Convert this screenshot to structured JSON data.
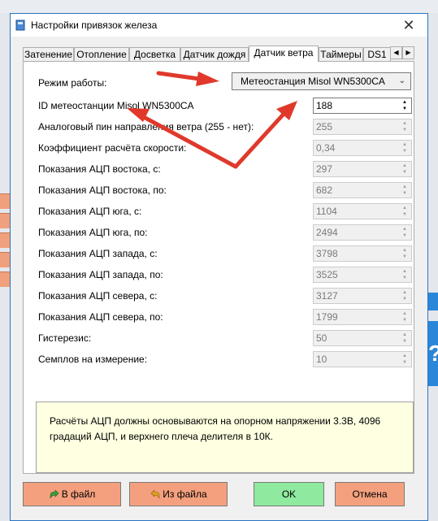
{
  "window": {
    "title": "Настройки привязок железа",
    "close_glyph": "✕"
  },
  "tabs": [
    "Затенение",
    "Отопление",
    "Досветка",
    "Датчик дождя",
    "Датчик ветра",
    "Таймеры",
    "DS1"
  ],
  "active_tab": "Датчик ветра",
  "tab_arrows": {
    "left": "◀",
    "right": "▶"
  },
  "form": {
    "mode_label": "Режим работы:",
    "mode_value": "Метеостанция Misol WN5300CA",
    "rows": [
      {
        "label": "ID метеостанции Misol WN5300CA",
        "value": "188",
        "enabled": true
      },
      {
        "label": "Аналоговый пин направления ветра (255 - нет):",
        "value": "255",
        "enabled": false
      },
      {
        "label": "Коэффициент расчёта скорости:",
        "value": "0,34",
        "enabled": false
      },
      {
        "label": "Показания АЦП востока, с:",
        "value": "297",
        "enabled": false
      },
      {
        "label": "Показания АЦП востока, по:",
        "value": "682",
        "enabled": false
      },
      {
        "label": "Показания АЦП юга, с:",
        "value": "1104",
        "enabled": false
      },
      {
        "label": "Показания АЦП юга, по:",
        "value": "2494",
        "enabled": false
      },
      {
        "label": "Показания АЦП запада, с:",
        "value": "3798",
        "enabled": false
      },
      {
        "label": "Показания АЦП запада, по:",
        "value": "3525",
        "enabled": false
      },
      {
        "label": "Показания АЦП севера, с:",
        "value": "3127",
        "enabled": false
      },
      {
        "label": "Показания АЦП севера, по:",
        "value": "1799",
        "enabled": false
      },
      {
        "label": "Гистерезис:",
        "value": "50",
        "enabled": false
      },
      {
        "label": "Семплов на измерение:",
        "value": "10",
        "enabled": false
      }
    ]
  },
  "note": "Расчёты АЦП должны основываются на опорном напряжении 3.3В, 4096 градаций АЦП, и верхнего плеча делителя в 10К.",
  "buttons": {
    "to_file": "В файл",
    "from_file": "Из файла",
    "ok": "OK",
    "cancel": "Отмена"
  },
  "background": {
    "right_glyph": "?"
  },
  "colors": {
    "orange": "#f4a07e",
    "green": "#8fe99f",
    "note_bg": "#ffffe1",
    "arrow": "#e0392b"
  }
}
